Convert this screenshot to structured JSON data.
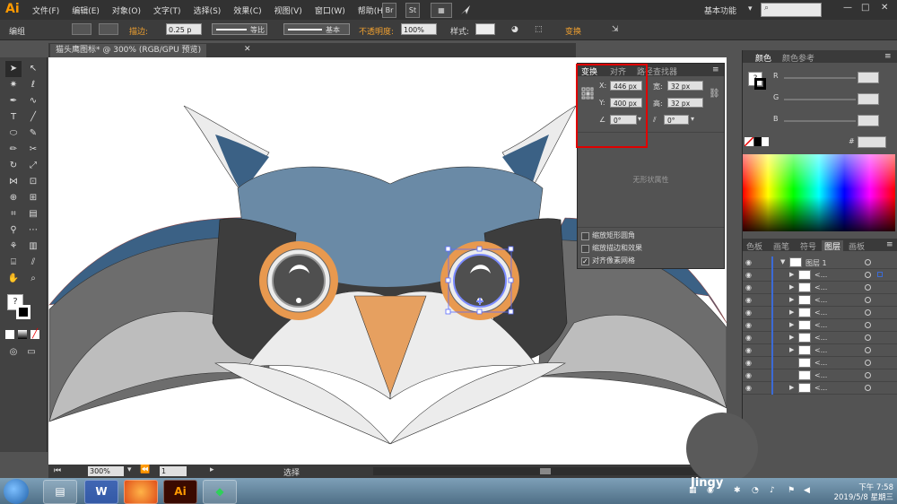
{
  "app": {
    "logo": "Ai",
    "workspace": "基本功能"
  },
  "menu": [
    "文件(F)",
    "编辑(E)",
    "对象(O)",
    "文字(T)",
    "选择(S)",
    "效果(C)",
    "视图(V)",
    "窗口(W)",
    "帮助(H)"
  ],
  "menubar_icons": {
    "bridge": "Br",
    "stock": "St",
    "arrange": "▦",
    "rocket": "rocket-icon"
  },
  "control_bar": {
    "selection_label": "编组",
    "stroke_label": "描边:",
    "stroke_value": "0.25 p",
    "profile_label": "等比",
    "brush_label": "基本",
    "opacity_label": "不透明度:",
    "opacity_value": "100%",
    "style_label": "样式:",
    "transform_label": "变换"
  },
  "document": {
    "tab_title": "猫头鹰图标* @ 300% (RGB/GPU 预览)"
  },
  "status": {
    "zoom": "300%",
    "page": "1",
    "tool_text": "选择"
  },
  "transform_panel": {
    "tabs": [
      "变换",
      "对齐",
      "路径查找器"
    ],
    "x_label": "X:",
    "x_value": "446 px",
    "y_label": "Y:",
    "y_value": "400 px",
    "w_label": "宽:",
    "w_value": "32 px",
    "h_label": "高:",
    "h_value": "32 px",
    "angle_value": "0°",
    "shear_value": "0°",
    "no_shape_text": "无形状属性",
    "options": [
      {
        "label": "缩放矩形圆角",
        "checked": false
      },
      {
        "label": "缩放描边和效果",
        "checked": false
      },
      {
        "label": "对齐像素网格",
        "checked": true
      }
    ]
  },
  "color_panel": {
    "tabs": [
      "颜色",
      "颜色参考"
    ],
    "channels": [
      "R",
      "G",
      "B"
    ],
    "hex_label": "#"
  },
  "layers_panel": {
    "tabs": [
      "色板",
      "画笔",
      "符号",
      "图层",
      "画板"
    ],
    "top_layer": "图层 1",
    "rows": [
      "<...",
      "<...",
      "<...",
      "<...",
      "<...",
      "<...",
      "<...",
      "<...",
      "<...",
      "<..."
    ]
  },
  "taskbar": {
    "apps": [
      "file-explorer",
      "word",
      "firefox",
      "illustrator",
      "green-app"
    ],
    "illustrator_label": "Ai",
    "word_label": "W",
    "time": "下午 7:58",
    "date": "2019/5/8 星期三",
    "watermark": "Jingy"
  },
  "colors": {
    "owl_blue_dark": "#3b6185",
    "owl_blue_light": "#6a8aa6",
    "owl_gray_dark": "#3d3d3d",
    "owl_gray_mid": "#6d6d6d",
    "owl_gray_light": "#bdbdbd",
    "owl_white": "#ececec",
    "owl_orange": "#e6a060",
    "highlight_red": "#e00000"
  }
}
